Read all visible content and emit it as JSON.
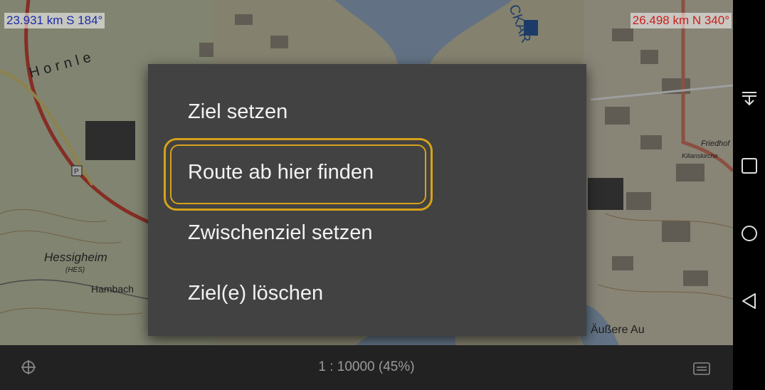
{
  "map": {
    "distance_left": "23.931 km S 184°",
    "distance_right": "26.498 km N 340°",
    "labels": {
      "hornle": "Hornle",
      "hessigheim": "Hessigheim",
      "hes": "(HES)",
      "hambach": "Hambach",
      "aussere_au": "Äußere Au",
      "friedhof": "Friedhof",
      "kilianskirche": "Kilianskirche",
      "neckar": "CKAR"
    }
  },
  "context_menu": {
    "items": [
      {
        "label": "Ziel setzen"
      },
      {
        "label": "Route ab hier finden"
      },
      {
        "label": "Zwischenziel setzen"
      },
      {
        "label": "Ziel(e) löschen"
      }
    ],
    "focused_index": 1,
    "focus_color": "#d7a21a",
    "background": "#424242"
  },
  "bottom_bar": {
    "scale": "1 : 10000  (45%)",
    "left_icon": "crosshair-icon",
    "right_icon": "menu-lines-icon"
  },
  "nav_bar": {
    "icons": [
      "notification-pulldown-icon",
      "recents-square-icon",
      "home-circle-icon",
      "back-triangle-icon"
    ]
  }
}
